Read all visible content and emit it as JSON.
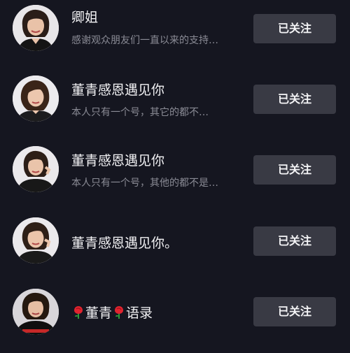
{
  "accounts": [
    {
      "name": "卿姐",
      "desc": "感谢观众朋友们一直以来的支持…",
      "button": "已关注"
    },
    {
      "name": "董青感恩遇见你",
      "desc": "本人只有一个号，其它的都不…",
      "button": "已关注"
    },
    {
      "name": "董青感恩遇见你",
      "desc": "本人只有一个号，其他的都不是…",
      "button": "已关注"
    },
    {
      "name": "董青感恩遇见你。",
      "desc": "",
      "button": "已关注"
    },
    {
      "name_part1": "董青",
      "name_part2": "语录",
      "name_icon": "rose-icon",
      "desc": "",
      "button": "已关注"
    }
  ],
  "colors": {
    "background": "#151620",
    "button_bg": "#393a44",
    "secondary_text": "#8a8b95",
    "rose": "#e0242f"
  }
}
